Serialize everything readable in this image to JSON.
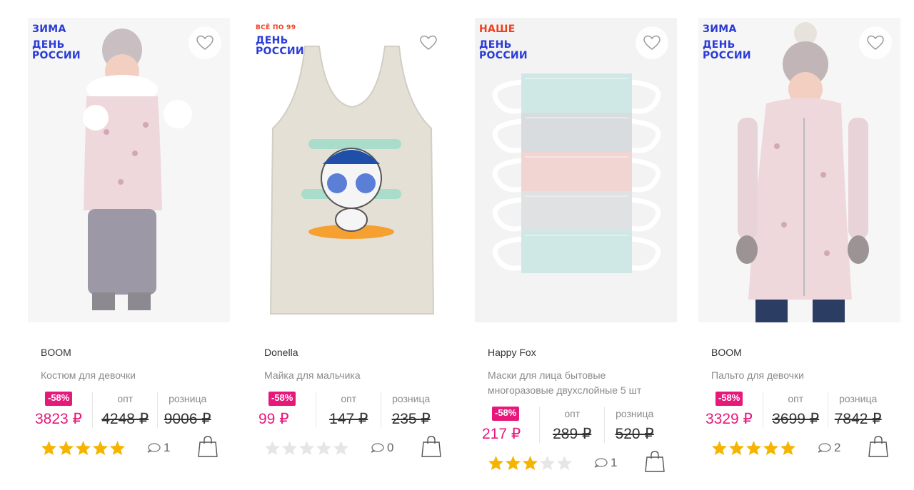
{
  "currency": "₽",
  "labels": {
    "wholesale": "опт",
    "retail": "розница"
  },
  "products": [
    {
      "badges": [
        "ЗИМА",
        "ДЕНЬ",
        "РОССИИ"
      ],
      "brand": "BOOM",
      "title": "Костюм для девочки",
      "discount": "-58%",
      "price": "3823 ₽",
      "wholesale": "4248 ₽",
      "retail": "9006 ₽",
      "rating": 5,
      "comments": "1"
    },
    {
      "badges": [
        "ВСЁ ПО 99",
        "ДЕНЬ",
        "РОССИИ"
      ],
      "brand": "Donella",
      "title": "Майка для мальчика",
      "discount": "-58%",
      "price": "99 ₽",
      "wholesale": "147 ₽",
      "retail": "235 ₽",
      "rating": 0,
      "comments": "0"
    },
    {
      "badges": [
        "НАШЕ",
        "ДЕНЬ",
        "РОССИИ"
      ],
      "brand": "Happy Fox",
      "title": "Маски для лица бытовые многоразовые двухслойные 5 шт",
      "discount": "-58%",
      "price": "217 ₽",
      "wholesale": "289 ₽",
      "retail": "520 ₽",
      "rating": 3,
      "comments": "1"
    },
    {
      "badges": [
        "ЗИМА",
        "ДЕНЬ",
        "РОССИИ"
      ],
      "brand": "BOOM",
      "title": "Пальто для девочки",
      "discount": "-58%",
      "price": "3329 ₽",
      "wholesale": "3699 ₽",
      "retail": "7842 ₽",
      "rating": 5,
      "comments": "2"
    }
  ],
  "colors": {
    "sale": "#e6197b",
    "badge_blue": "#2a3bd6",
    "badge_red": "#f04020",
    "star_on": "#f5b400",
    "star_off": "#e6e6e6"
  },
  "icons": {
    "favorite": "heart-icon",
    "comments": "comment-bubble-icon",
    "cart": "shopping-bag-icon",
    "rating": "star-icon"
  }
}
